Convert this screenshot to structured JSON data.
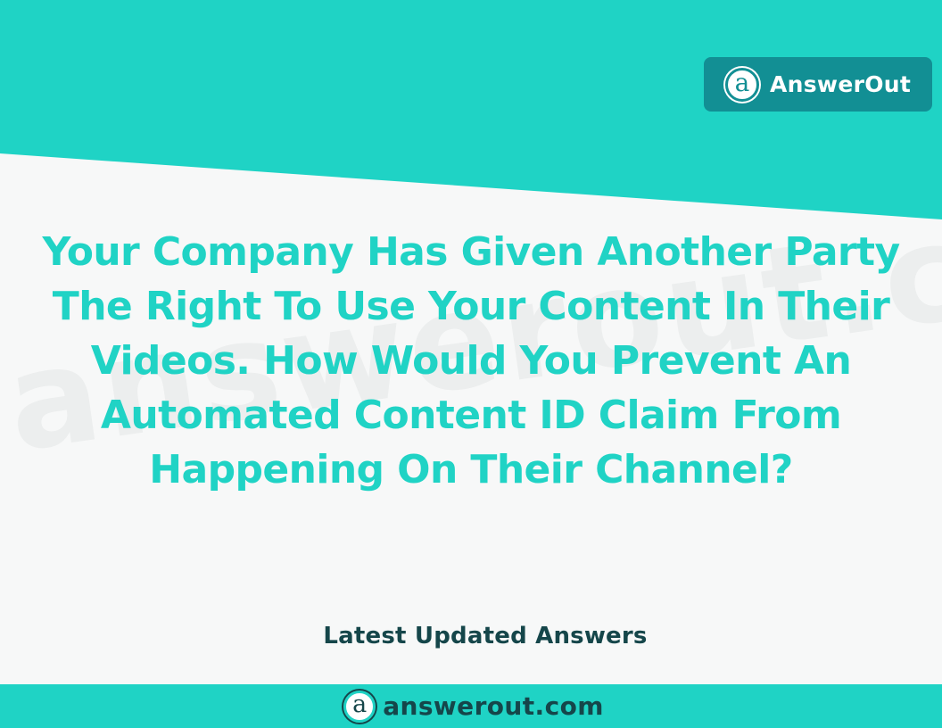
{
  "header": {
    "brand_name": "AnswerOut",
    "logo_glyph": "a",
    "logo_icon": "answerout-logo-icon"
  },
  "watermark": {
    "text": "answerout.com"
  },
  "main": {
    "question": "Your Company Has Given Another Party The Right To Use Your Content In Their Videos. How Would You Prevent An Automated Content ID Claim From Happening On Their Channel?",
    "latest_label": "Latest Updated Answers"
  },
  "footer": {
    "url": "answerout.com",
    "logo_glyph": "a"
  },
  "colors": {
    "teal": "#1fd3c5",
    "dark_teal_badge": "#128f94",
    "dark_text": "#15464a",
    "question_text": "#20d3c5",
    "background": "#f7f8f8"
  }
}
